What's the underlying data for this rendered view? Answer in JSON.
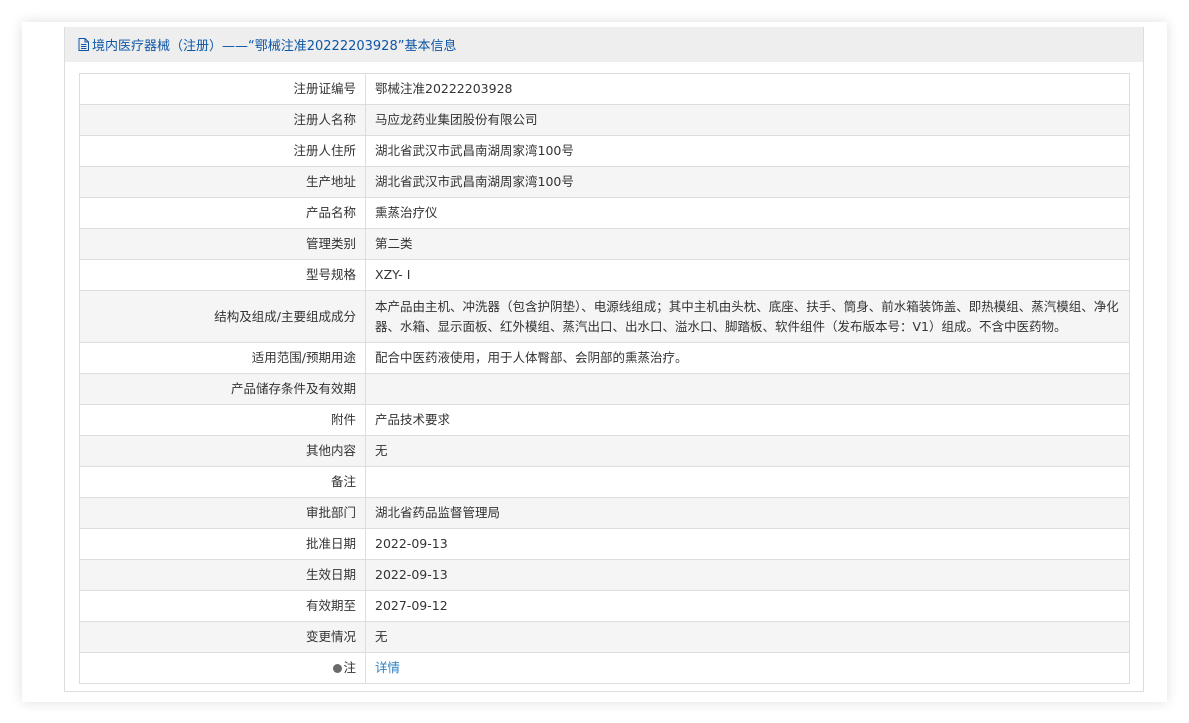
{
  "header": {
    "icon": "document-icon",
    "title": "境内医疗器械（注册）——“鄂械注准20222203928”基本信息"
  },
  "rows": [
    {
      "label": "注册证编号",
      "value": "鄂械注准20222203928"
    },
    {
      "label": "注册人名称",
      "value": "马应龙药业集团股份有限公司"
    },
    {
      "label": "注册人住所",
      "value": "湖北省武汉市武昌南湖周家湾100号"
    },
    {
      "label": "生产地址",
      "value": "湖北省武汉市武昌南湖周家湾100号"
    },
    {
      "label": "产品名称",
      "value": "熏蒸治疗仪"
    },
    {
      "label": "管理类别",
      "value": "第二类"
    },
    {
      "label": "型号规格",
      "value": "XZY- I"
    },
    {
      "label": "结构及组成/主要组成成分",
      "value": "本产品由主机、冲洗器（包含护阴垫）、电源线组成；其中主机由头枕、底座、扶手、筒身、前水箱装饰盖、即热模组、蒸汽模组、净化器、水箱、显示面板、红外模组、蒸汽出口、出水口、溢水口、脚踏板、软件组件（发布版本号：V1）组成。不含中医药物。"
    },
    {
      "label": "适用范围/预期用途",
      "value": "配合中医药液使用，用于人体臀部、会阴部的熏蒸治疗。"
    },
    {
      "label": "产品储存条件及有效期",
      "value": ""
    },
    {
      "label": "附件",
      "value": "产品技术要求"
    },
    {
      "label": "其他内容",
      "value": "无"
    },
    {
      "label": "备注",
      "value": ""
    },
    {
      "label": "审批部门",
      "value": "湖北省药品监督管理局"
    },
    {
      "label": "批准日期",
      "value": "2022-09-13"
    },
    {
      "label": "生效日期",
      "value": "2022-09-13"
    },
    {
      "label": "有效期至",
      "value": "2027-09-12"
    },
    {
      "label": "变更情况",
      "value": "无"
    }
  ],
  "note": {
    "icon": "bulb-icon",
    "label": "注",
    "link_text": "详情"
  },
  "colors": {
    "header_text": "#0e56a5",
    "link": "#2e7fc0",
    "header_bg": "#eeeeee",
    "stripe_bg": "#f5f5f5"
  }
}
